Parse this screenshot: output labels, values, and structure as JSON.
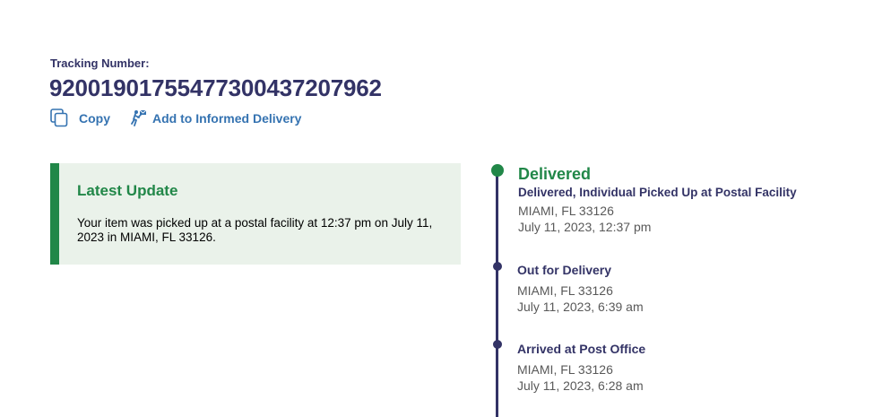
{
  "tracking": {
    "label": "Tracking Number:",
    "number": "9200190175547730043720796​2"
  },
  "actions": {
    "copy_label": "Copy",
    "informed_label": "Add to Informed Delivery"
  },
  "latest_update": {
    "title": "Latest Update",
    "text": "Your item was picked up at a postal facility at 12:37 pm on July 11, 2023 in MIAMI, FL 33126."
  },
  "events": [
    {
      "status": "Delivered",
      "detail": "Delivered, Individual Picked Up at Postal Facility",
      "location": "MIAMI, FL 33126",
      "time": "July 11, 2023, 12:37 pm"
    },
    {
      "status": "Out for Delivery",
      "location": "MIAMI, FL 33126",
      "time": "July 11, 2023, 6:39 am"
    },
    {
      "status": "Arrived at Post Office",
      "location": "MIAMI, FL 33126",
      "time": "July 11, 2023, 6:28 am"
    }
  ],
  "colors": {
    "navy": "#333366",
    "green": "#218748",
    "link_blue": "#3573b1",
    "update_bg": "#eaf2ea"
  },
  "icons": {
    "copy": "copy-icon",
    "informed": "informed-delivery-icon"
  }
}
